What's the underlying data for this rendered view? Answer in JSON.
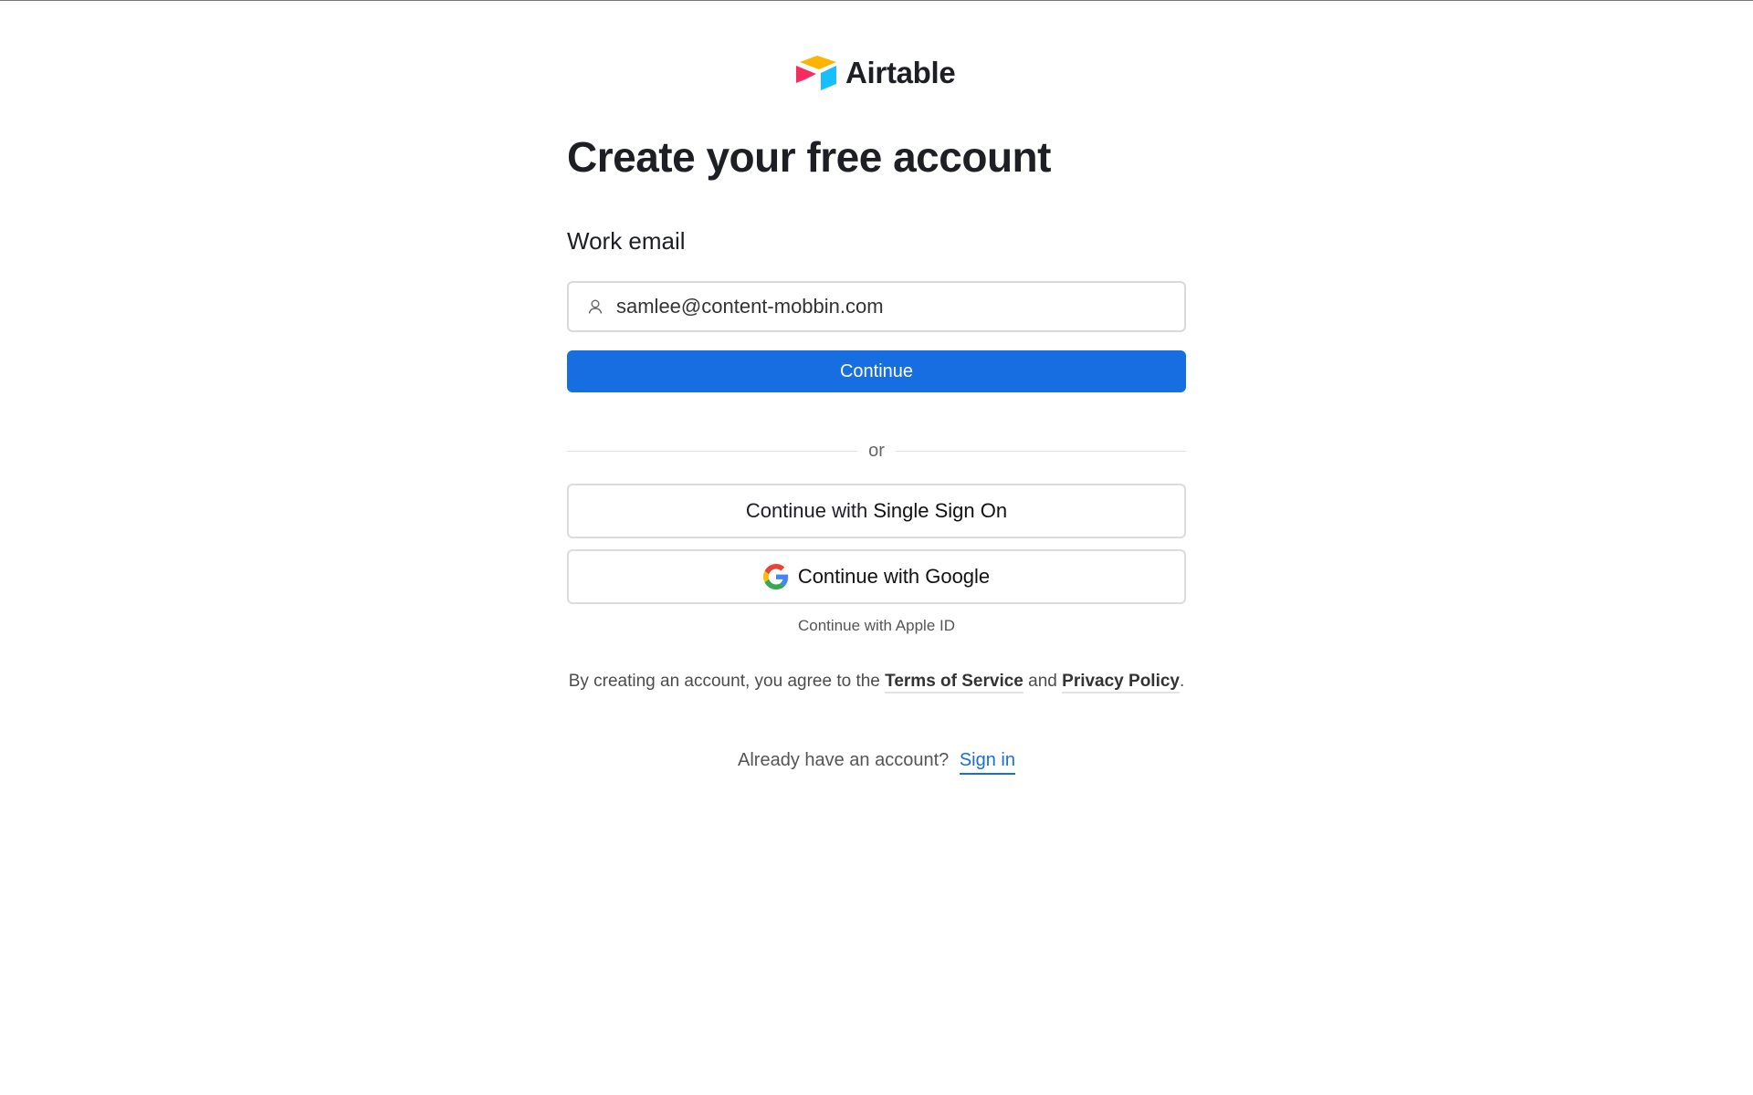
{
  "brand": {
    "name": "Airtable",
    "logo_icon": "airtable-logo-icon",
    "colors": {
      "yellow": "#fcb400",
      "cyan": "#18bfff",
      "red": "#f82b60",
      "dark_red": "#ba1e45"
    }
  },
  "page": {
    "title": "Create your free account"
  },
  "form": {
    "email_label": "Work email",
    "email_value": "samlee@content-mobbin.com",
    "email_icon": "user-icon",
    "continue_label": "Continue",
    "primary_color": "#166ee1"
  },
  "divider": {
    "label": "or"
  },
  "alt_options": {
    "sso_prefix": "Continue with ",
    "sso_bold": "Single Sign On",
    "google_label": "Continue with Google",
    "google_icon": "google-icon",
    "apple_label": "Continue with Apple ID"
  },
  "legal": {
    "prefix": "By creating an account, you agree to the ",
    "terms_label": "Terms of Service",
    "conjunction": " and ",
    "privacy_label": "Privacy Policy",
    "suffix": "."
  },
  "signin": {
    "prompt": "Already have an account?",
    "link_label": "Sign in"
  }
}
